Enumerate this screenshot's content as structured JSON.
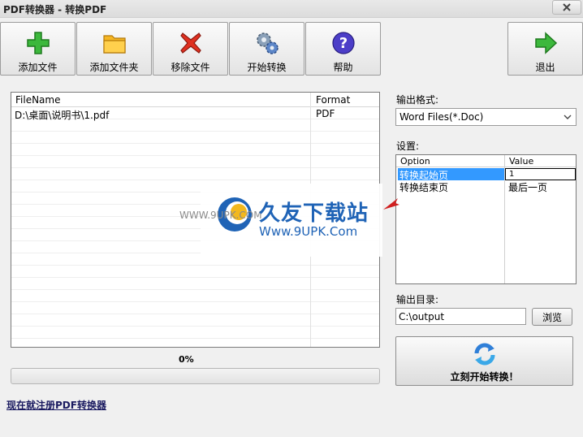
{
  "window": {
    "title": "PDF转换器 - 转换PDF"
  },
  "toolbar": {
    "add_file": "添加文件",
    "add_folder": "添加文件夹",
    "remove_file": "移除文件",
    "start_convert": "开始转换",
    "help": "帮助",
    "exit": "退出"
  },
  "file_list": {
    "columns": {
      "name": "FileName",
      "format": "Format"
    },
    "rows": [
      {
        "name": "D:\\桌面\\说明书\\1.pdf",
        "format": "PDF"
      }
    ]
  },
  "progress": {
    "text": "0%",
    "value": 0
  },
  "register_link": "现在就注册PDF转换器",
  "output_format": {
    "label": "输出格式:",
    "selected": "Word Files(*.Doc)"
  },
  "settings": {
    "label": "设置:",
    "columns": {
      "option": "Option",
      "value": "Value"
    },
    "rows": [
      {
        "option": "转换起始页",
        "value": "1"
      },
      {
        "option": "转换结束页",
        "value": "最后一页"
      }
    ]
  },
  "output_dir": {
    "label": "输出目录:",
    "value": "C:\\output",
    "browse": "浏览"
  },
  "start_now": "立刻开始转换！",
  "watermark": {
    "brand": "久友下载站",
    "url": "Www.9UPK.Com",
    "small": "WWW.9UPK.COM"
  }
}
